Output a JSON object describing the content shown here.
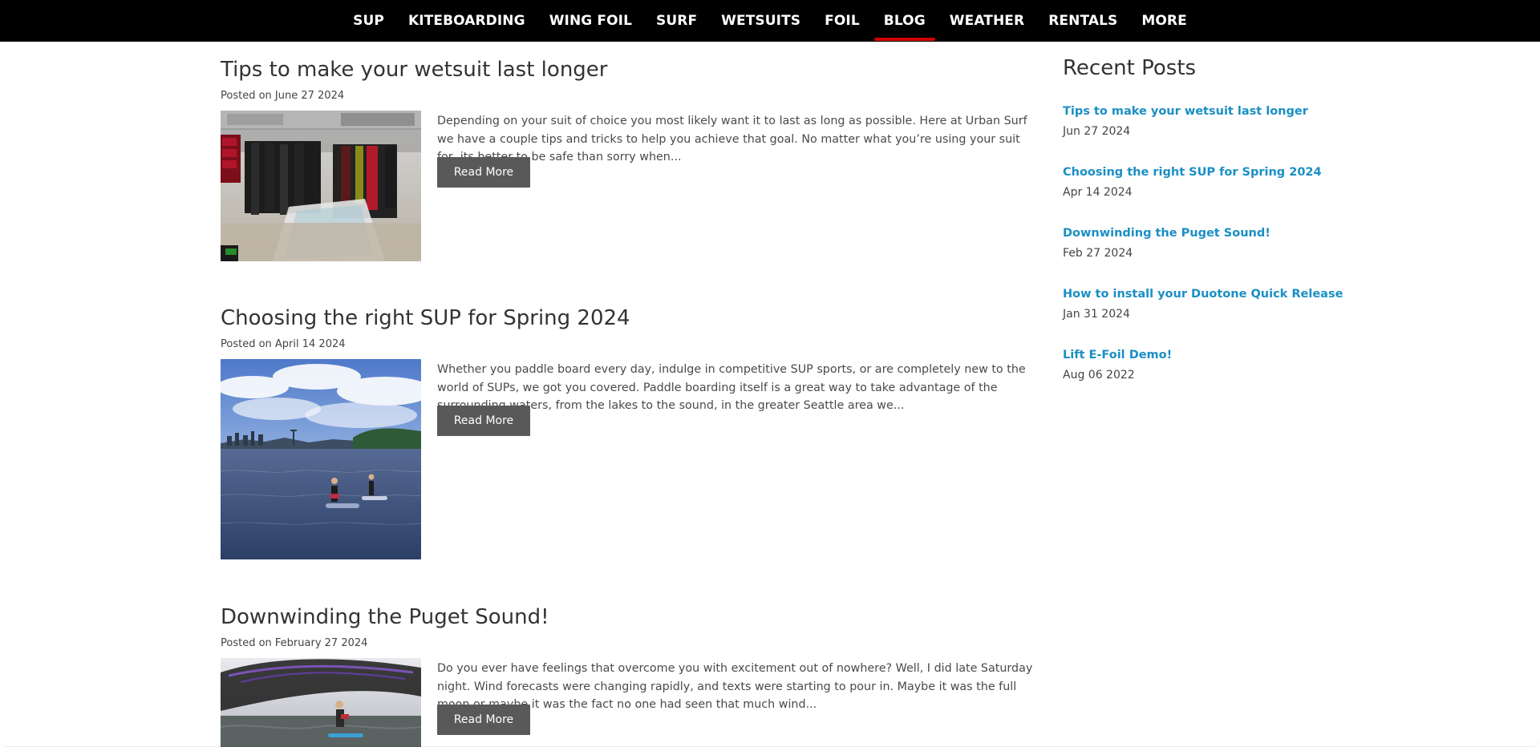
{
  "nav": {
    "items": [
      {
        "label": "SUP",
        "active": false
      },
      {
        "label": "KITEBOARDING",
        "active": false
      },
      {
        "label": "WING FOIL",
        "active": false
      },
      {
        "label": "SURF",
        "active": false
      },
      {
        "label": "WETSUITS",
        "active": false
      },
      {
        "label": "FOIL",
        "active": false
      },
      {
        "label": "BLOG",
        "active": true
      },
      {
        "label": "WEATHER",
        "active": false
      },
      {
        "label": "RENTALS",
        "active": false
      },
      {
        "label": "MORE",
        "active": false
      }
    ],
    "active_underline_color": "#d00000",
    "background": "#000000"
  },
  "posts": [
    {
      "title": "Tips to make your wetsuit last longer",
      "posted_on": "Posted on June 27 2024",
      "excerpt": "Depending on your suit of choice you most likely want it to last as long as possible. Here at Urban Surf we have a couple tips and tricks to help you achieve that goal. No matter what you’re using your suit for, its better to be safe than sorry when...",
      "read_more_label": "Read More",
      "image_name": "wetsuit-store-photo"
    },
    {
      "title": "Choosing the right SUP for Spring 2024",
      "posted_on": "Posted on April 14 2024",
      "excerpt": "Whether you paddle board every day, indulge in competitive SUP sports, or are completely new to the world of SUPs, we got you covered. Paddle boarding itself is a great way to take advantage of the surrounding waters, from the lakes to the sound, in the greater Seattle area we...",
      "read_more_label": "Read More",
      "image_name": "seattle-sup-photo"
    },
    {
      "title": "Downwinding the Puget Sound!",
      "posted_on": "Posted on February 27 2024",
      "excerpt": "Do you ever have feelings that overcome you with excitement out of nowhere? Well, I did late Saturday night. Wind forecasts were changing rapidly, and texts were starting to pour in. Maybe it was the full moon or maybe it was the fact no one had seen that much wind...",
      "read_more_label": "Read More",
      "image_name": "wing-foil-photo"
    }
  ],
  "sidebar": {
    "title": "Recent Posts",
    "items": [
      {
        "label": "Tips to make your wetsuit last longer",
        "date": "Jun 27 2024"
      },
      {
        "label": "Choosing the right SUP for Spring 2024",
        "date": "Apr 14 2024"
      },
      {
        "label": "Downwinding the Puget Sound!",
        "date": "Feb 27 2024"
      },
      {
        "label": "How to install your Duotone Quick Release",
        "date": "Jan 31 2024"
      },
      {
        "label": "Lift E-Foil Demo!",
        "date": "Aug 06 2022"
      }
    ],
    "link_color": "#1a8fc4"
  },
  "colors": {
    "read_more_bg": "#595959",
    "text": "#333333"
  }
}
